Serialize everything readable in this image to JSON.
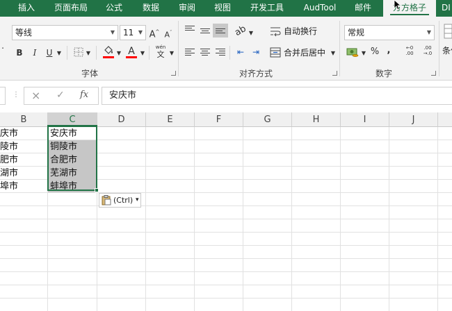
{
  "tabs": [
    {
      "label": "插入"
    },
    {
      "label": "页面布局"
    },
    {
      "label": "公式"
    },
    {
      "label": "数据"
    },
    {
      "label": "审阅"
    },
    {
      "label": "视图"
    },
    {
      "label": "开发工具"
    },
    {
      "label": "AudTool"
    },
    {
      "label": "邮件"
    },
    {
      "label": "方方格子",
      "active": true
    },
    {
      "label": "DI"
    }
  ],
  "ribbon": {
    "font": {
      "name": "等线",
      "size": "11",
      "grow_label": "A",
      "shrink_label": "A",
      "bold": "B",
      "italic": "I",
      "underline": "U",
      "font_color_label": "A",
      "phonetic_label": "wén",
      "phonetic_char": "文",
      "group_label": "字体",
      "fill_color": "#ff0000",
      "font_color": "#ff0000"
    },
    "align": {
      "wrap_label": "自动换行",
      "merge_label": "合并后居中",
      "group_label": "对齐方式"
    },
    "number": {
      "format": "常规",
      "percent": "%",
      "comma": ",",
      "inc_decimal_top": "←0",
      "inc_decimal_bottom": ".00",
      "dec_decimal_top": ".00",
      "dec_decimal_bottom": "→.0",
      "group_label": "数字"
    },
    "styles": {
      "conditional_label": "条件"
    }
  },
  "formula_bar": {
    "cancel": "×",
    "enter": "✓",
    "fx": "fx",
    "content": "安庆市"
  },
  "columns": [
    "B",
    "C",
    "D",
    "E",
    "F",
    "G",
    "H",
    "I",
    "J"
  ],
  "selected_column": "C",
  "column_b_values": [
    "安庆市",
    "铜陵市",
    "合肥市",
    "芜湖市",
    "蚌埠市"
  ],
  "column_c_values": [
    "安庆市",
    "铜陵市",
    "合肥市",
    "芜湖市",
    "蚌埠市"
  ],
  "paste_options": {
    "label": "(Ctrl)",
    "arrow": "▾"
  },
  "colors": {
    "accent": "#217346",
    "selection": "#c6c6c6"
  }
}
